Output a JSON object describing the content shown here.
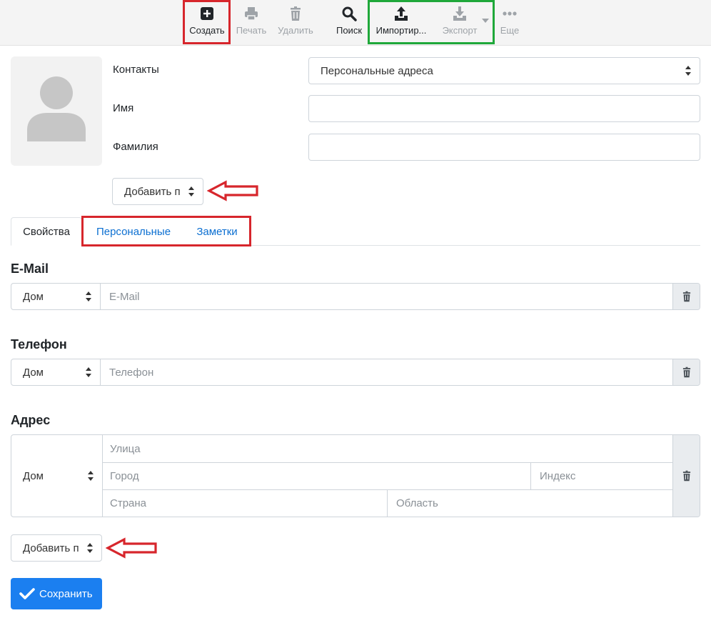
{
  "toolbar": {
    "create": "Создать",
    "print": "Печать",
    "delete": "Удалить",
    "search": "Поиск",
    "import": "Импортир...",
    "export": "Экспорт",
    "more": "Еще"
  },
  "header": {
    "contacts_label": "Контакты",
    "addressbook_value": "Персональные адреса",
    "first_name_label": "Имя",
    "last_name_label": "Фамилия",
    "add_field_label": "Добавить п"
  },
  "tabs": [
    {
      "label": "Свойства",
      "active": true
    },
    {
      "label": "Персональные",
      "active": false
    },
    {
      "label": "Заметки",
      "active": false
    }
  ],
  "email": {
    "title": "E-Mail",
    "type": "Дом",
    "placeholder": "E-Mail"
  },
  "phone": {
    "title": "Телефон",
    "type": "Дом",
    "placeholder": "Телефон"
  },
  "address": {
    "title": "Адрес",
    "type": "Дом",
    "street": "Улица",
    "city": "Город",
    "zip": "Индекс",
    "country": "Страна",
    "region": "Область"
  },
  "footer": {
    "add_field_label": "Добавить п",
    "save_label": "Сохранить"
  },
  "colors": {
    "primary": "#1b7ff0",
    "link": "#0c6fd1",
    "annotation_red": "#d7262c",
    "annotation_green": "#1fa83a"
  }
}
